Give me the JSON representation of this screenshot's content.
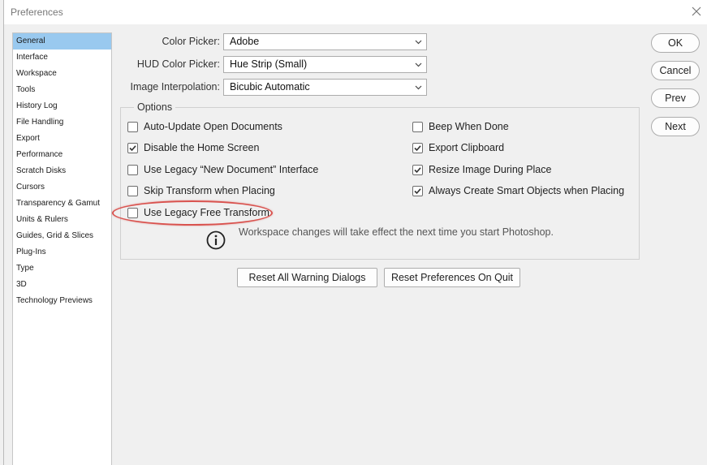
{
  "window": {
    "title": "Preferences"
  },
  "sidebar": {
    "items": [
      {
        "label": "General",
        "active": true
      },
      {
        "label": "Interface"
      },
      {
        "label": "Workspace"
      },
      {
        "label": "Tools"
      },
      {
        "label": "History Log"
      },
      {
        "label": "File Handling"
      },
      {
        "label": "Export"
      },
      {
        "label": "Performance"
      },
      {
        "label": "Scratch Disks"
      },
      {
        "label": "Cursors"
      },
      {
        "label": "Transparency & Gamut"
      },
      {
        "label": "Units & Rulers"
      },
      {
        "label": "Guides, Grid & Slices"
      },
      {
        "label": "Plug-Ins"
      },
      {
        "label": "Type"
      },
      {
        "label": "3D"
      },
      {
        "label": "Technology Previews"
      }
    ]
  },
  "fields": {
    "color_picker": {
      "label": "Color Picker:",
      "value": "Adobe"
    },
    "hud_color_picker": {
      "label": "HUD Color Picker:",
      "value": "Hue Strip (Small)"
    },
    "image_interpolation": {
      "label": "Image Interpolation:",
      "value": "Bicubic Automatic"
    }
  },
  "options": {
    "legend": "Options",
    "left": [
      {
        "label": "Auto-Update Open Documents",
        "checked": false
      },
      {
        "label": "Disable the Home Screen",
        "checked": true
      },
      {
        "label": "Use Legacy “New Document” Interface",
        "checked": false
      },
      {
        "label": "Skip Transform when Placing",
        "checked": false
      },
      {
        "label": "Use Legacy Free Transform",
        "checked": false
      }
    ],
    "right": [
      {
        "label": "Beep When Done",
        "checked": false
      },
      {
        "label": "Export Clipboard",
        "checked": true
      },
      {
        "label": "Resize Image During Place",
        "checked": true
      },
      {
        "label": "Always Create Smart Objects when Placing",
        "checked": true
      }
    ],
    "info_text": "Workspace changes will take effect the next time you start Photoshop."
  },
  "buttons": {
    "ok": "OK",
    "cancel": "Cancel",
    "prev": "Prev",
    "next": "Next",
    "reset_warnings": "Reset All Warning Dialogs",
    "reset_on_quit": "Reset Preferences On Quit"
  },
  "colors": {
    "sidebar_active": "#99c9ef",
    "annotation": "#d9534f"
  }
}
